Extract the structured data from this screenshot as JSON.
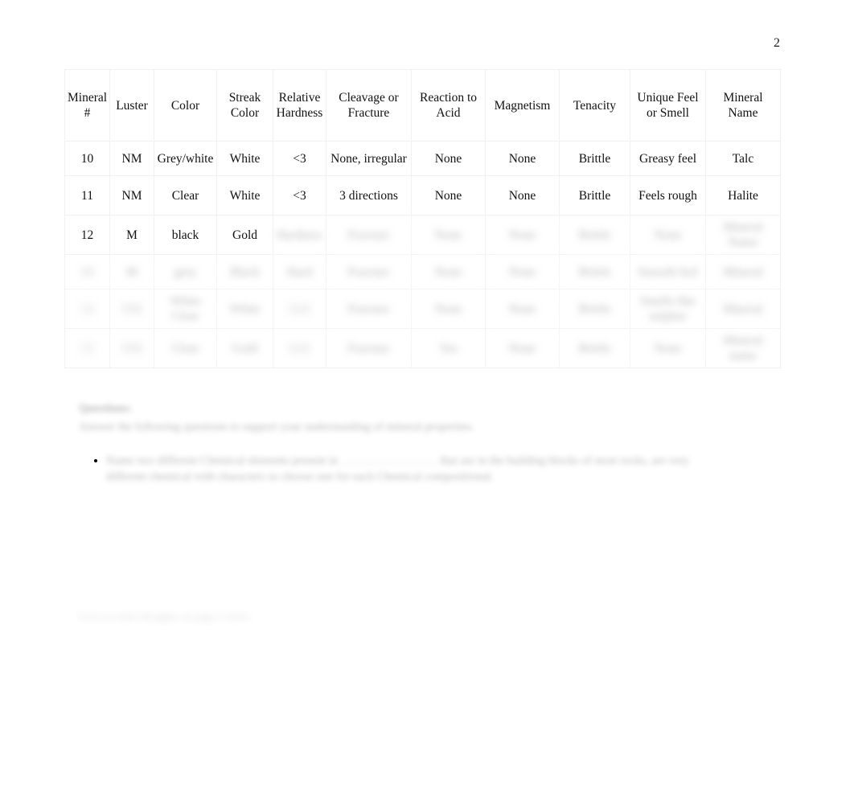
{
  "document": {
    "page_number": "2",
    "background_color": "#ffffff",
    "text_color": "#111111"
  },
  "table": {
    "name": "mineral-identification-table",
    "headers": [
      "Mineral #",
      "Luster",
      "Color",
      "Streak Color",
      "Relative Hardness",
      "Cleavage or Fracture",
      "Reaction to Acid",
      "Magnetism",
      "Tenacity",
      "Unique Feel or Smell",
      "Mineral Name"
    ],
    "rows": [
      {
        "legible": true,
        "cells": [
          "10",
          "NM",
          "Grey/white",
          "White",
          "<3",
          "None, irregular",
          "None",
          "None",
          "Brittle",
          "Greasy feel",
          "Talc"
        ]
      },
      {
        "legible": true,
        "cells": [
          "11",
          "NM",
          "Clear",
          "White",
          "<3",
          "3 directions",
          "None",
          "None",
          "Brittle",
          "Feels rough",
          "Halite"
        ]
      },
      {
        "legible": "partial",
        "cells": [
          "12",
          "M",
          "black",
          "Gold",
          "",
          "",
          "",
          "",
          "",
          "",
          ""
        ],
        "blurred_cells": [
          "",
          "",
          "",
          "",
          "Hardness",
          "Fracture",
          "None",
          "None",
          "Brittle",
          "None",
          "Mineral Name"
        ]
      },
      {
        "legible": false,
        "blurred_cells": [
          "13",
          "M",
          "grey",
          "Black",
          "Hard",
          "Fracture",
          "None",
          "None",
          "Brittle",
          "Smooth feel",
          "Mineral"
        ]
      },
      {
        "legible": false,
        "blurred_cells": [
          "14",
          "NM",
          "White Clear",
          "White",
          "Soft",
          "Fracture",
          "None",
          "None",
          "Brittle",
          "Smells like sulphur",
          "Mineral"
        ]
      },
      {
        "legible": false,
        "blurred_cells": [
          "15",
          "NM",
          "Clear",
          "Gold",
          "Soft",
          "Fracture",
          "Yes",
          "None",
          "Brittle",
          "None",
          "Mineral name"
        ]
      }
    ]
  },
  "questions": {
    "heading": "Questions:",
    "intro": "Answer the following questions to support your understanding of mineral properties.",
    "items": [
      {
        "text_before_blank": "Name two different Chemical elements present in",
        "blank": "",
        "text_after_blank": "that are in the building blocks of most rocks, are very different chemical with characters so choose one for each Chemical compositional."
      }
    ]
  },
  "footer": {
    "note": "Give us some thoughts on page 2 notes."
  }
}
